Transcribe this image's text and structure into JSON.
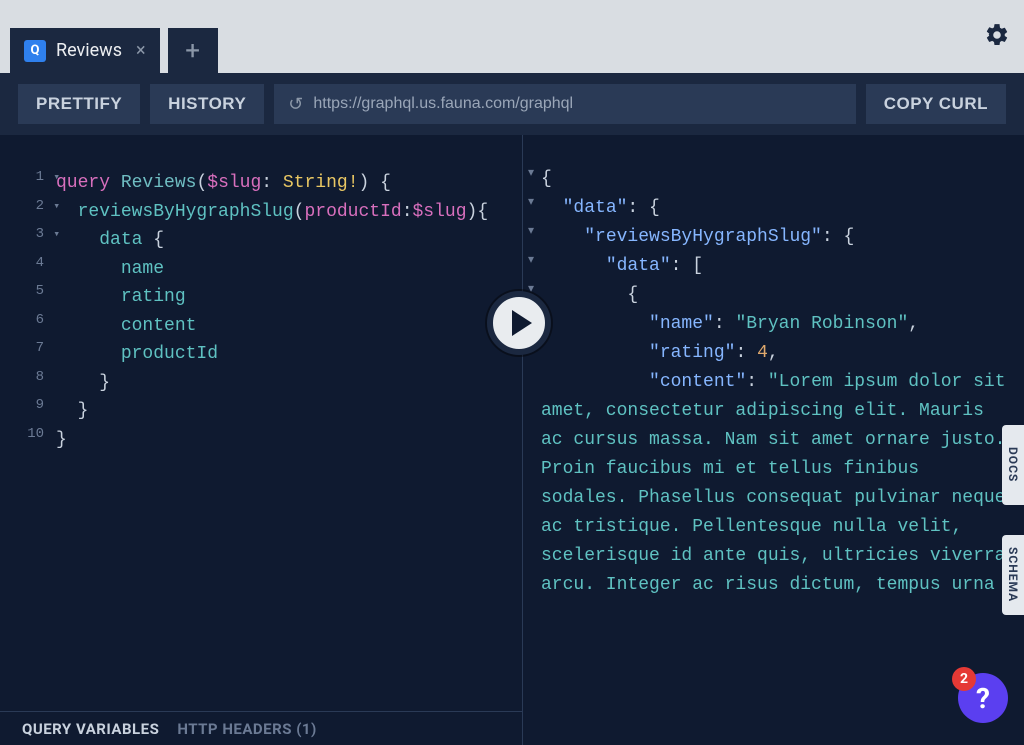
{
  "tab": {
    "icon_letter": "Q",
    "title": "Reviews"
  },
  "toolbar": {
    "prettify": "PRETTIFY",
    "history": "HISTORY",
    "url": "https://graphql.us.fauna.com/graphql",
    "copy_curl": "COPY CURL"
  },
  "editor": {
    "lines": [
      1,
      2,
      3,
      4,
      5,
      6,
      7,
      8,
      9,
      10
    ],
    "foldable": [
      1,
      2,
      3
    ],
    "query_keyword": "query",
    "op_name": "Reviews",
    "var_name": "$slug",
    "var_type": "String",
    "bang": "!",
    "resolver": "reviewsByHygraphSlug",
    "arg_name": "productId",
    "field_data": "data",
    "fields": {
      "name": "name",
      "rating": "rating",
      "content": "content",
      "productId": "productId"
    }
  },
  "result": {
    "key_data": "\"data\"",
    "key_resolver": "\"reviewsByHygraphSlug\"",
    "key_data2": "\"data\"",
    "key_name": "\"name\"",
    "val_name": "\"Bryan Robinson\"",
    "key_rating": "\"rating\"",
    "val_rating": "4",
    "key_content": "\"content\"",
    "val_content": "\"Lorem ipsum dolor sit amet, consectetur adipiscing elit. Mauris ac cursus massa. Nam sit amet ornare justo. Proin faucibus mi et tellus finibus sodales. Phasellus consequat pulvinar neque ac tristique. Pellentesque nulla velit, scelerisque id ante quis, ultricies viverra arcu. Integer ac risus dictum, tempus urna"
  },
  "footer": {
    "query_vars": "QUERY VARIABLES",
    "http_headers": "HTTP HEADERS (1)"
  },
  "side": {
    "docs": "DOCS",
    "schema": "SCHEMA"
  },
  "help": {
    "count": "2",
    "symbol": "?"
  }
}
